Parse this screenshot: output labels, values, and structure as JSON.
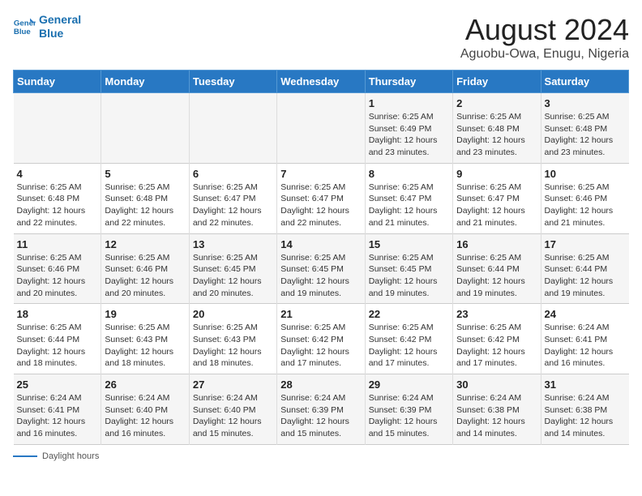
{
  "logo": {
    "line1": "General",
    "line2": "Blue"
  },
  "title": "August 2024",
  "subtitle": "Aguobu-Owa, Enugu, Nigeria",
  "days_of_week": [
    "Sunday",
    "Monday",
    "Tuesday",
    "Wednesday",
    "Thursday",
    "Friday",
    "Saturday"
  ],
  "weeks": [
    [
      {
        "num": "",
        "info": ""
      },
      {
        "num": "",
        "info": ""
      },
      {
        "num": "",
        "info": ""
      },
      {
        "num": "",
        "info": ""
      },
      {
        "num": "1",
        "info": "Sunrise: 6:25 AM\nSunset: 6:49 PM\nDaylight: 12 hours\nand 23 minutes."
      },
      {
        "num": "2",
        "info": "Sunrise: 6:25 AM\nSunset: 6:48 PM\nDaylight: 12 hours\nand 23 minutes."
      },
      {
        "num": "3",
        "info": "Sunrise: 6:25 AM\nSunset: 6:48 PM\nDaylight: 12 hours\nand 23 minutes."
      }
    ],
    [
      {
        "num": "4",
        "info": "Sunrise: 6:25 AM\nSunset: 6:48 PM\nDaylight: 12 hours\nand 22 minutes."
      },
      {
        "num": "5",
        "info": "Sunrise: 6:25 AM\nSunset: 6:48 PM\nDaylight: 12 hours\nand 22 minutes."
      },
      {
        "num": "6",
        "info": "Sunrise: 6:25 AM\nSunset: 6:47 PM\nDaylight: 12 hours\nand 22 minutes."
      },
      {
        "num": "7",
        "info": "Sunrise: 6:25 AM\nSunset: 6:47 PM\nDaylight: 12 hours\nand 22 minutes."
      },
      {
        "num": "8",
        "info": "Sunrise: 6:25 AM\nSunset: 6:47 PM\nDaylight: 12 hours\nand 21 minutes."
      },
      {
        "num": "9",
        "info": "Sunrise: 6:25 AM\nSunset: 6:47 PM\nDaylight: 12 hours\nand 21 minutes."
      },
      {
        "num": "10",
        "info": "Sunrise: 6:25 AM\nSunset: 6:46 PM\nDaylight: 12 hours\nand 21 minutes."
      }
    ],
    [
      {
        "num": "11",
        "info": "Sunrise: 6:25 AM\nSunset: 6:46 PM\nDaylight: 12 hours\nand 20 minutes."
      },
      {
        "num": "12",
        "info": "Sunrise: 6:25 AM\nSunset: 6:46 PM\nDaylight: 12 hours\nand 20 minutes."
      },
      {
        "num": "13",
        "info": "Sunrise: 6:25 AM\nSunset: 6:45 PM\nDaylight: 12 hours\nand 20 minutes."
      },
      {
        "num": "14",
        "info": "Sunrise: 6:25 AM\nSunset: 6:45 PM\nDaylight: 12 hours\nand 19 minutes."
      },
      {
        "num": "15",
        "info": "Sunrise: 6:25 AM\nSunset: 6:45 PM\nDaylight: 12 hours\nand 19 minutes."
      },
      {
        "num": "16",
        "info": "Sunrise: 6:25 AM\nSunset: 6:44 PM\nDaylight: 12 hours\nand 19 minutes."
      },
      {
        "num": "17",
        "info": "Sunrise: 6:25 AM\nSunset: 6:44 PM\nDaylight: 12 hours\nand 19 minutes."
      }
    ],
    [
      {
        "num": "18",
        "info": "Sunrise: 6:25 AM\nSunset: 6:44 PM\nDaylight: 12 hours\nand 18 minutes."
      },
      {
        "num": "19",
        "info": "Sunrise: 6:25 AM\nSunset: 6:43 PM\nDaylight: 12 hours\nand 18 minutes."
      },
      {
        "num": "20",
        "info": "Sunrise: 6:25 AM\nSunset: 6:43 PM\nDaylight: 12 hours\nand 18 minutes."
      },
      {
        "num": "21",
        "info": "Sunrise: 6:25 AM\nSunset: 6:42 PM\nDaylight: 12 hours\nand 17 minutes."
      },
      {
        "num": "22",
        "info": "Sunrise: 6:25 AM\nSunset: 6:42 PM\nDaylight: 12 hours\nand 17 minutes."
      },
      {
        "num": "23",
        "info": "Sunrise: 6:25 AM\nSunset: 6:42 PM\nDaylight: 12 hours\nand 17 minutes."
      },
      {
        "num": "24",
        "info": "Sunrise: 6:24 AM\nSunset: 6:41 PM\nDaylight: 12 hours\nand 16 minutes."
      }
    ],
    [
      {
        "num": "25",
        "info": "Sunrise: 6:24 AM\nSunset: 6:41 PM\nDaylight: 12 hours\nand 16 minutes."
      },
      {
        "num": "26",
        "info": "Sunrise: 6:24 AM\nSunset: 6:40 PM\nDaylight: 12 hours\nand 16 minutes."
      },
      {
        "num": "27",
        "info": "Sunrise: 6:24 AM\nSunset: 6:40 PM\nDaylight: 12 hours\nand 15 minutes."
      },
      {
        "num": "28",
        "info": "Sunrise: 6:24 AM\nSunset: 6:39 PM\nDaylight: 12 hours\nand 15 minutes."
      },
      {
        "num": "29",
        "info": "Sunrise: 6:24 AM\nSunset: 6:39 PM\nDaylight: 12 hours\nand 15 minutes."
      },
      {
        "num": "30",
        "info": "Sunrise: 6:24 AM\nSunset: 6:38 PM\nDaylight: 12 hours\nand 14 minutes."
      },
      {
        "num": "31",
        "info": "Sunrise: 6:24 AM\nSunset: 6:38 PM\nDaylight: 12 hours\nand 14 minutes."
      }
    ]
  ],
  "footer_label": "Daylight hours"
}
